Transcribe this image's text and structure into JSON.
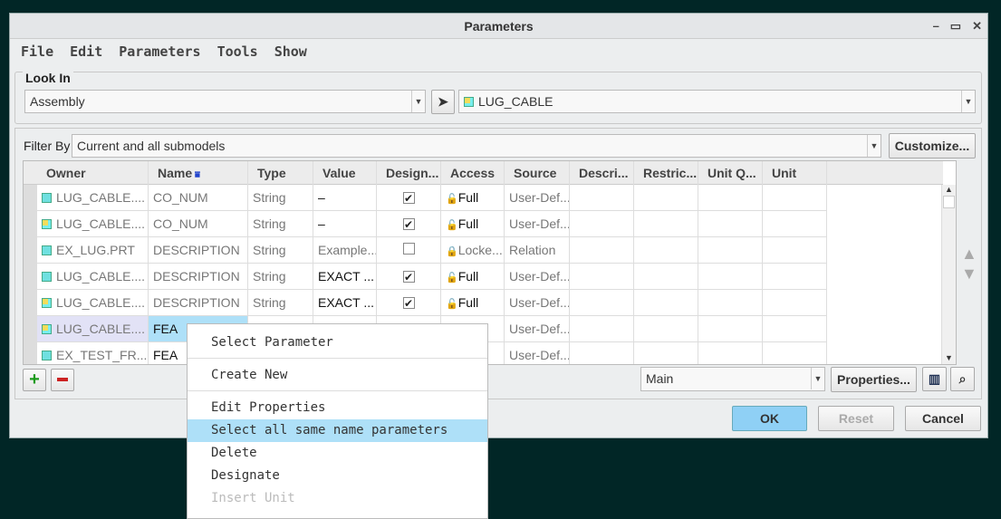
{
  "window": {
    "title": "Parameters",
    "controls": [
      "–",
      "▭",
      "✕"
    ]
  },
  "menu": [
    "File",
    "Edit",
    "Parameters",
    "Tools",
    "Show"
  ],
  "look_in": {
    "label": "Look In",
    "type": "Assembly",
    "model": "LUG_CABLE"
  },
  "filter": {
    "label": "Filter By",
    "value": "Current and all submodels",
    "customize": "Customize..."
  },
  "table": {
    "columns": [
      "Owner",
      "Name",
      "Type",
      "Value",
      "Design...",
      "Access",
      "Source",
      "Descri...",
      "Restric...",
      "Unit Q...",
      "Unit"
    ],
    "sort_icon": "sort-down-icon",
    "rows": [
      {
        "icon": "part",
        "owner": "LUG_CABLE....",
        "name": "CO_NUM",
        "type": "String",
        "value": "–",
        "designated": true,
        "access": "Full",
        "source": "User-Def..."
      },
      {
        "icon": "asm",
        "owner": "LUG_CABLE....",
        "name": "CO_NUM",
        "type": "String",
        "value": "–",
        "designated": true,
        "access": "Full",
        "source": "User-Def..."
      },
      {
        "icon": "part",
        "owner": "EX_LUG.PRT",
        "name": "DESCRIPTION",
        "type": "String",
        "value": "Example...",
        "designated": false,
        "access": "Locke...",
        "source": "Relation"
      },
      {
        "icon": "part",
        "owner": "LUG_CABLE....",
        "name": "DESCRIPTION",
        "type": "String",
        "value": "EXACT ...",
        "designated": true,
        "access": "Full",
        "source": "User-Def..."
      },
      {
        "icon": "asm",
        "owner": "LUG_CABLE....",
        "name": "DESCRIPTION",
        "type": "String",
        "value": "EXACT ...",
        "designated": true,
        "access": "Full",
        "source": "User-Def..."
      },
      {
        "icon": "asm",
        "owner": "LUG_CABLE....",
        "name": "FEA",
        "type": "",
        "value": "",
        "designated": null,
        "access": "",
        "source": "User-Def..."
      },
      {
        "icon": "part",
        "owner": "EX_TEST_FR...",
        "name": "FEA",
        "type": "",
        "value": "",
        "designated": null,
        "access": "",
        "source": "User-Def..."
      }
    ]
  },
  "bottom": {
    "view": "Main",
    "properties": "Properties..."
  },
  "buttons": {
    "ok": "OK",
    "reset": "Reset",
    "cancel": "Cancel"
  },
  "context_menu": [
    "Select Parameter",
    "Create New",
    "Edit Properties",
    "Select all same name parameters",
    "Delete",
    "Designate",
    "Insert Unit"
  ],
  "colors": {
    "highlight": "#aee0f8",
    "ok": "#8fd0f5"
  }
}
